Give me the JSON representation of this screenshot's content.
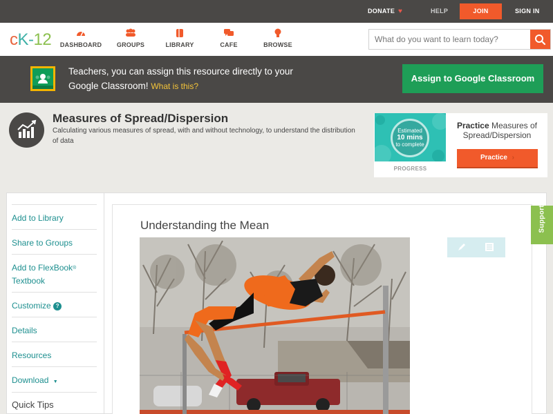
{
  "topbar": {
    "donate": "DONATE",
    "help": "HELP",
    "join": "JOIN",
    "signin": "SIGN IN"
  },
  "nav": {
    "logo": {
      "c": "c",
      "k": "K",
      "dash": "-",
      "n": "12"
    },
    "items": [
      {
        "label": "DASHBOARD",
        "icon": "dashboard-gauge-icon"
      },
      {
        "label": "GROUPS",
        "icon": "groups-people-icon"
      },
      {
        "label": "LIBRARY",
        "icon": "library-book-icon"
      },
      {
        "label": "CAFE",
        "icon": "cafe-chat-icon"
      },
      {
        "label": "BROWSE",
        "icon": "browse-bulb-icon"
      }
    ],
    "search_placeholder": "What do you want to learn today?"
  },
  "banner": {
    "text": "Teachers, you can assign this resource directly to your Google Classroom!",
    "what": "What is this?",
    "assign_label": "Assign to Google Classroom"
  },
  "concept": {
    "title": "Measures of Spread/Dispersion",
    "description": "Calculating various measures of spread, with and without technology, to understand the distribution of data"
  },
  "practice": {
    "estimated": "Estimated",
    "mins": "10 mins",
    "to_complete": "to complete",
    "progress_label": "PROGRESS",
    "title_bold": "Practice",
    "title_rest": " Measures of Spread/Dispersion",
    "button_label": "Practice"
  },
  "sidebar": {
    "items": [
      {
        "label": "Add to Library"
      },
      {
        "label": "Share to Groups"
      },
      {
        "label": "Add to FlexBook",
        "sup": "®",
        "line2": "Textbook"
      },
      {
        "label": "Customize",
        "help": "?"
      },
      {
        "label": "Details"
      },
      {
        "label": "Resources"
      },
      {
        "label": "Download",
        "caret": "▼"
      }
    ],
    "quick_tips": "Quick Tips"
  },
  "article": {
    "title": "Understanding the Mean"
  },
  "support": "Support",
  "colors": {
    "brand_orange": "#f15a2b",
    "teal": "#1d8f8f",
    "green": "#1e9e57",
    "dark": "#4a4846"
  }
}
